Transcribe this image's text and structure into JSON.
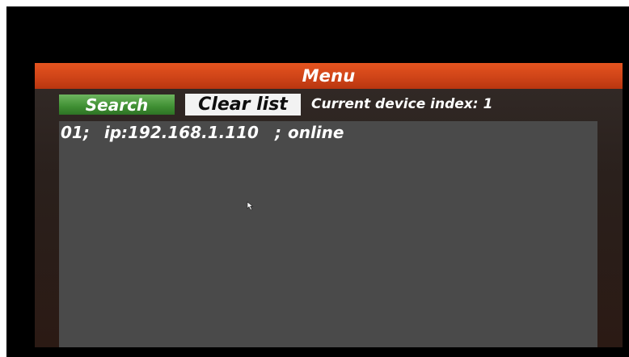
{
  "menu": {
    "title": "Menu"
  },
  "toolbar": {
    "search_label": "Search",
    "clear_label": "Clear list",
    "device_index_label": "Current device index:",
    "device_index_value": "1"
  },
  "devices": [
    {
      "index": "01;",
      "ip": "ip:192.168.1.110",
      "separator": ";",
      "status": "online"
    }
  ],
  "colors": {
    "title_bar": "#d64a1a",
    "search_button": "#4a9a3d",
    "clear_button": "#f2f2f2",
    "list_background": "#4a4a4a",
    "panel_background": "#2e221d",
    "screen_background": "#000000"
  },
  "icons": {
    "pointer": "mouse-pointer-icon"
  }
}
